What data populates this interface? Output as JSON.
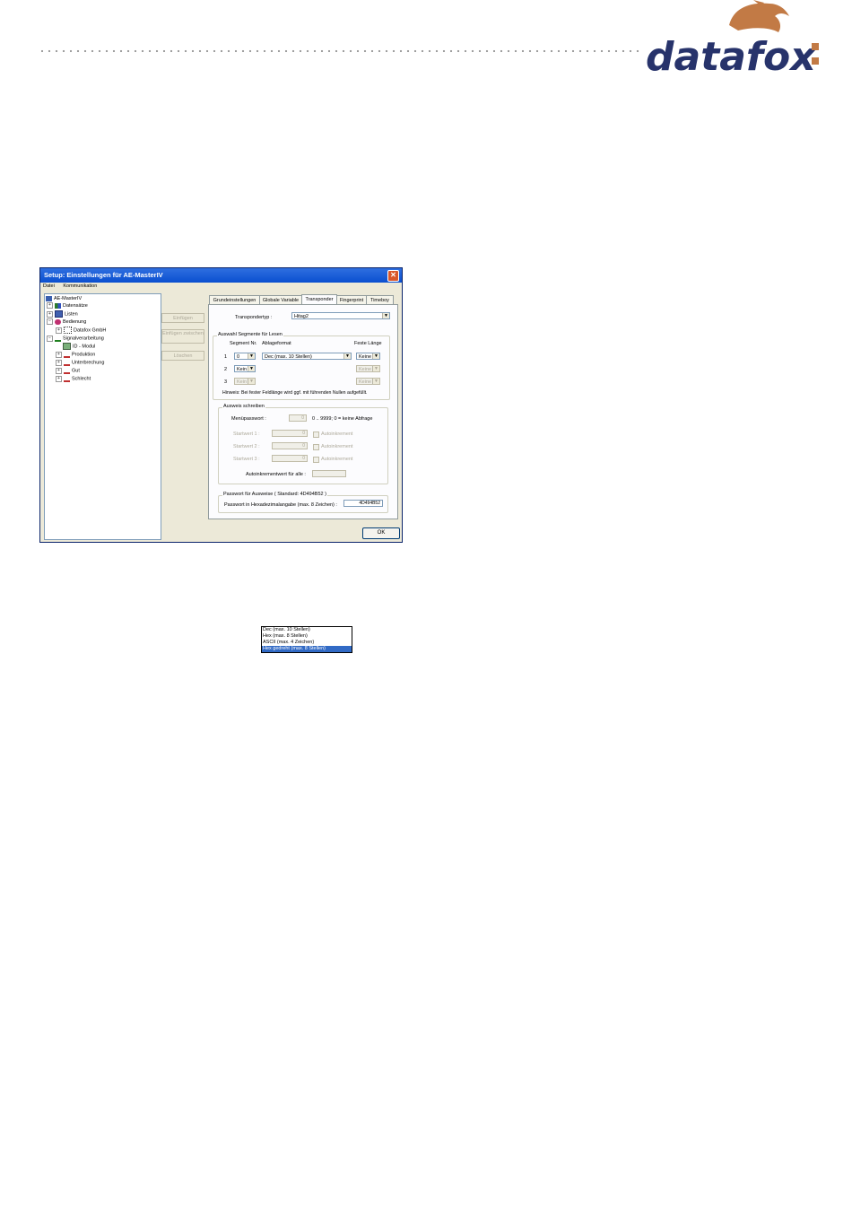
{
  "logo": {
    "text": "datafox",
    "text_color": "#27336b",
    "fox_color": "#c27a45"
  },
  "window": {
    "title": "Setup: Einstellungen für AE-MasterIV",
    "close_glyph": "✕",
    "menu": [
      "Datei",
      "Kommunikation"
    ]
  },
  "tree": {
    "items": [
      {
        "label": "AE-MasterIV",
        "expander": ""
      },
      {
        "label": "Datensätze",
        "expander": "+"
      },
      {
        "label": "Listen",
        "expander": "+"
      },
      {
        "label": "Bedienung",
        "expander": "−"
      },
      {
        "label": "Datafox GmbH",
        "expander": "+"
      },
      {
        "label": "Signalverarbeitung",
        "expander": "−"
      },
      {
        "label": "ID - Modul",
        "expander": ""
      },
      {
        "label": "Produktion",
        "expander": "+"
      },
      {
        "label": "Unterbrechung",
        "expander": "+"
      },
      {
        "label": "Gut",
        "expander": "+"
      },
      {
        "label": "Schlecht",
        "expander": "+"
      }
    ]
  },
  "side_buttons": {
    "insert": "Einfügen",
    "insert_between": "Einfügen zwischen",
    "delete": "Löschen"
  },
  "tabs": [
    "Grundeinstellungen",
    "Globale Variable",
    "Transponder",
    "Fingerprint",
    "Timeboy"
  ],
  "transponder": {
    "type_label": "Transpondertyp :",
    "type_value": "Hitag2",
    "segments_group": "Auswahl Segmente für Lesen",
    "col_segment": "Segment Nr.",
    "col_format": "Ablageformat",
    "col_fixed": "Feste Länge",
    "rows": [
      {
        "num": "1",
        "segment": "0",
        "format": "Dec (max. 10 Stellen)",
        "fixed": "Keine"
      },
      {
        "num": "2",
        "segment": "Kein",
        "fixed": "Keine"
      },
      {
        "num": "3",
        "segment": "Kein",
        "fixed": "Keine"
      }
    ],
    "format_options": [
      "Dec (max. 10 Stellen)",
      "Hex (max. 8 Stellen)",
      "ASCII (max. 4 Zeichen)",
      "Hex gedreht (max. 8 Stellen)"
    ],
    "selected_option_index": 3,
    "hint": "Hinweis: Bei fester Feldlänge wird ggf. mit führenden Nullen aufgefüllt.",
    "write_group": "Ausweis schreiben",
    "menu_password_label": "Menüpasswort :",
    "menu_password_value": "0",
    "menu_password_note": "0 .. 9999; 0 = keine Abfrage",
    "start_values": [
      {
        "label": "Startwert 1 :",
        "value": "0",
        "auto": "Autoinkrement"
      },
      {
        "label": "Startwert 2 :",
        "value": "0",
        "auto": "Autoinkrement"
      },
      {
        "label": "Startwert 3 :",
        "value": "0",
        "auto": "Autoinkrement"
      }
    ],
    "autoinc_label": "Autoinkrementwert für alle :",
    "autoinc_value": "",
    "password_group": "Passwort für Ausweise ( Standard: 4D494B52 )",
    "password_label": "Passwort in Hexadezimalangabe (max. 8 Zeichen) :",
    "password_value": "4D494B52"
  },
  "ok": "OK"
}
